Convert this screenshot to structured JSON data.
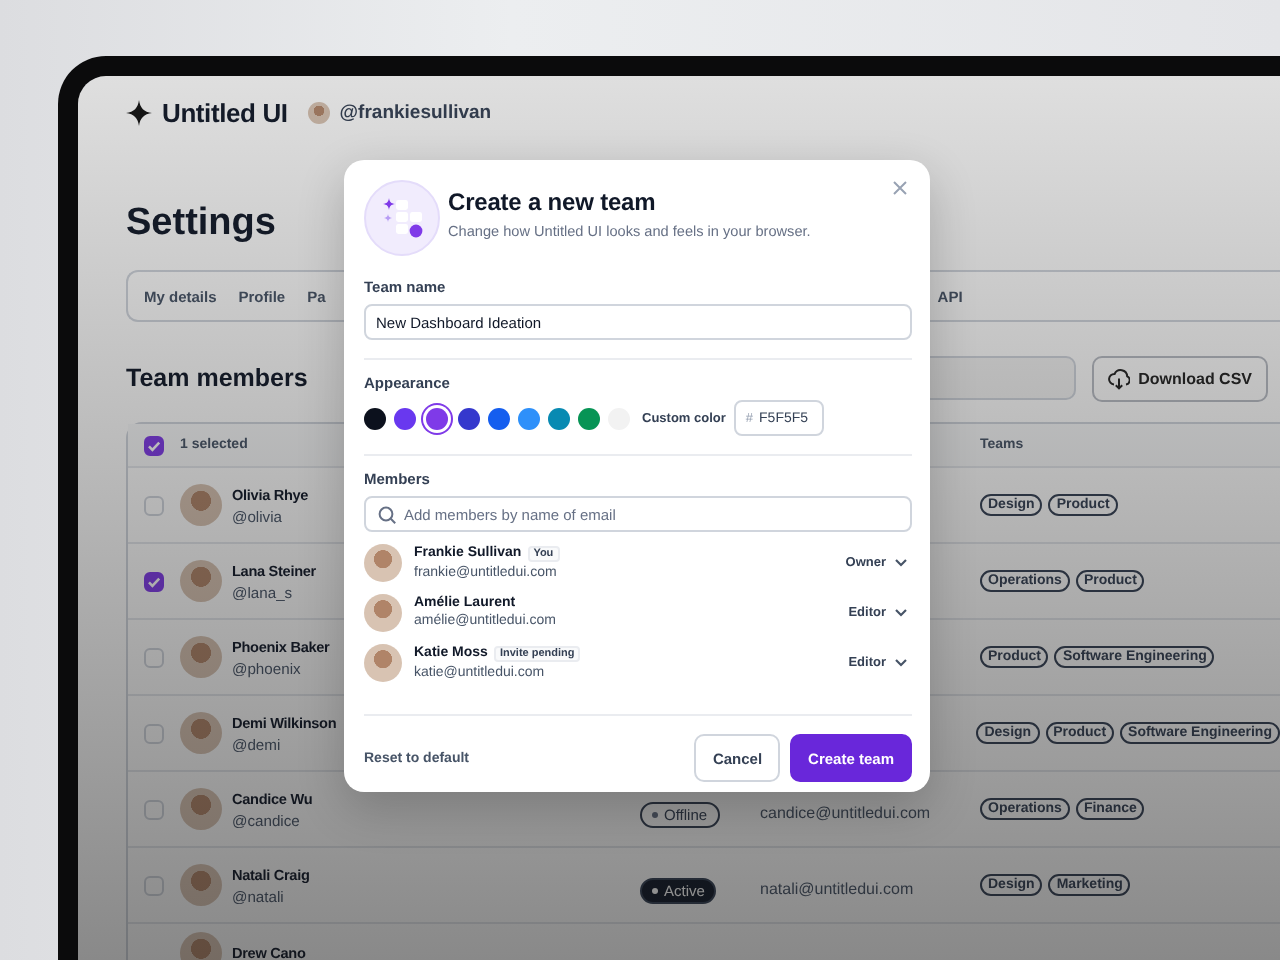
{
  "header": {
    "brand": "Untitled UI",
    "username": "@frankiesullivan"
  },
  "page_title": "Settings",
  "tabs": [
    {
      "label": "My details"
    },
    {
      "label": "Profile"
    },
    {
      "label": "Pa"
    },
    {
      "label": "API"
    }
  ],
  "section_title": "Team members",
  "download_button": "Download CSV",
  "table": {
    "header": {
      "checked": true,
      "selection": "1 selected",
      "teams_column": "Teams"
    },
    "rows": [
      {
        "name": "Olivia Rhye",
        "handle": "@olivia",
        "checked": false,
        "teams": [
          "Design",
          "Product"
        ]
      },
      {
        "name": "Lana Steiner",
        "handle": "@lana_s",
        "checked": true,
        "teams": [
          "Operations",
          "Product"
        ]
      },
      {
        "name": "Phoenix Baker",
        "handle": "@phoenix",
        "checked": false,
        "teams": [
          "Product",
          "Software Engineering"
        ]
      },
      {
        "name": "Demi Wilkinson",
        "handle": "@demi",
        "checked": false,
        "teams": [
          "Design",
          "Product",
          "Software Engineering"
        ]
      },
      {
        "name": "Candice Wu",
        "handle": "@candice",
        "checked": false,
        "status": {
          "kind": "offline",
          "label": "Offline"
        },
        "email": "candice@untitledui.com",
        "teams": [
          "Operations",
          "Finance"
        ]
      },
      {
        "name": "Natali Craig",
        "handle": "@natali",
        "checked": false,
        "status": {
          "kind": "active",
          "label": "Active"
        },
        "email": "natali@untitledui.com",
        "teams": [
          "Design",
          "Marketing"
        ]
      },
      {
        "name": "Drew Cano",
        "teams": []
      }
    ]
  },
  "modal": {
    "title": "Create a new team",
    "subtitle": "Change how Untitled UI looks and feels in your browser.",
    "team_name": {
      "label": "Team name",
      "value": "New Dashboard Ideation"
    },
    "appearance": {
      "label": "Appearance",
      "swatches": [
        {
          "color": "#0c111d",
          "selected": false
        },
        {
          "color": "#6938ef",
          "selected": false
        },
        {
          "color": "#7f3ae8",
          "selected": true
        },
        {
          "color": "#3538cd",
          "selected": false
        },
        {
          "color": "#155eef",
          "selected": false
        },
        {
          "color": "#2e90fa",
          "selected": false
        },
        {
          "color": "#088ab2",
          "selected": false
        },
        {
          "color": "#079455",
          "selected": false
        },
        {
          "color": "#f2f2f2",
          "selected": false
        }
      ],
      "custom_label": "Custom color",
      "custom_prefix": "#",
      "custom_value": "F5F5F5"
    },
    "members": {
      "label": "Members",
      "placeholder": "Add members by name of email",
      "people": [
        {
          "name": "Frankie Sullivan",
          "badge": "You",
          "email": "frankie@untitledui.com",
          "role": "Owner"
        },
        {
          "name": "Amélie Laurent",
          "email": "amélie@untitledui.com",
          "role": "Editor"
        },
        {
          "name": "Katie Moss",
          "badge": "Invite pending",
          "email": "katie@untitledui.com",
          "role": "Editor"
        }
      ]
    },
    "reset": "Reset to default",
    "cancel": "Cancel",
    "submit": "Create team"
  }
}
